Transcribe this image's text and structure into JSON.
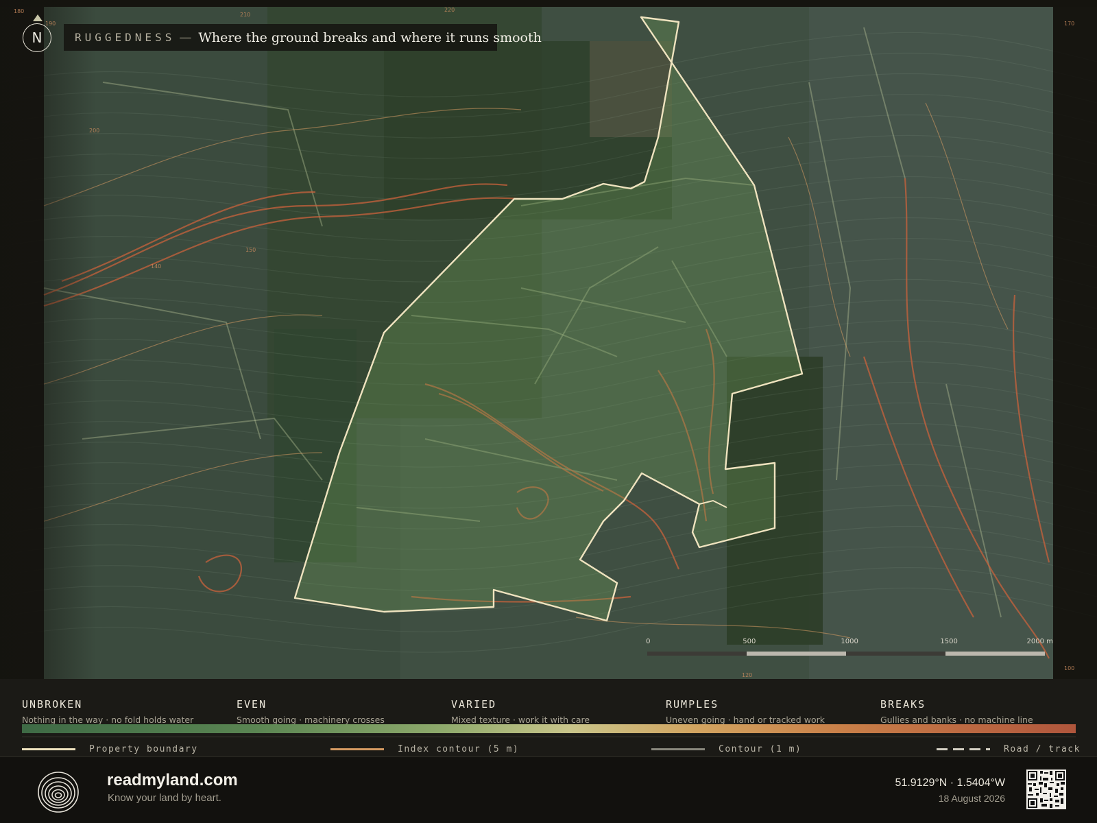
{
  "map": {
    "kicker": "RUGGEDNESS",
    "dash": "—",
    "title": "Where the ground breaks and where it runs smooth",
    "north": "N",
    "edge_labels": [
      {
        "text": "180",
        "pos": "top-left corner"
      },
      {
        "text": "190",
        "pos": "top edge"
      },
      {
        "text": "210",
        "pos": "top edge"
      },
      {
        "text": "220",
        "pos": "top edge"
      },
      {
        "text": "170",
        "pos": "right edge top"
      },
      {
        "text": "200",
        "pos": "left interior"
      },
      {
        "text": "150",
        "pos": "left interior"
      },
      {
        "text": "140",
        "pos": "left interior"
      },
      {
        "text": "120",
        "pos": "bottom edge"
      },
      {
        "text": "100",
        "pos": "right edge bottom"
      }
    ],
    "scale_ticks": [
      "0",
      "500",
      "1000",
      "1500",
      "2000 m"
    ]
  },
  "legend": {
    "classes": [
      {
        "name": "UNBROKEN",
        "desc": "Nothing in the way · no fold holds water"
      },
      {
        "name": "EVEN",
        "desc": "Smooth going · machinery crosses"
      },
      {
        "name": "VARIED",
        "desc": "Mixed texture · work it with care"
      },
      {
        "name": "RUMPLES",
        "desc": "Uneven going · hand or tracked work"
      },
      {
        "name": "BREAKS",
        "desc": "Gullies and banks · no machine line"
      }
    ],
    "keys": [
      {
        "label": "Property boundary",
        "color": "#efe3bf"
      },
      {
        "label": "Index contour (5 m)",
        "color": "#d59a62"
      },
      {
        "label": "Contour (1 m)",
        "color": "#8a887d"
      },
      {
        "label": "Road / track",
        "color": "#d4d0c4"
      }
    ]
  },
  "footer": {
    "brand": "readmyland.com",
    "tagline": "Know your land by heart.",
    "coords": "51.9129°N · 1.5404°W",
    "date": "18 August 2026"
  }
}
